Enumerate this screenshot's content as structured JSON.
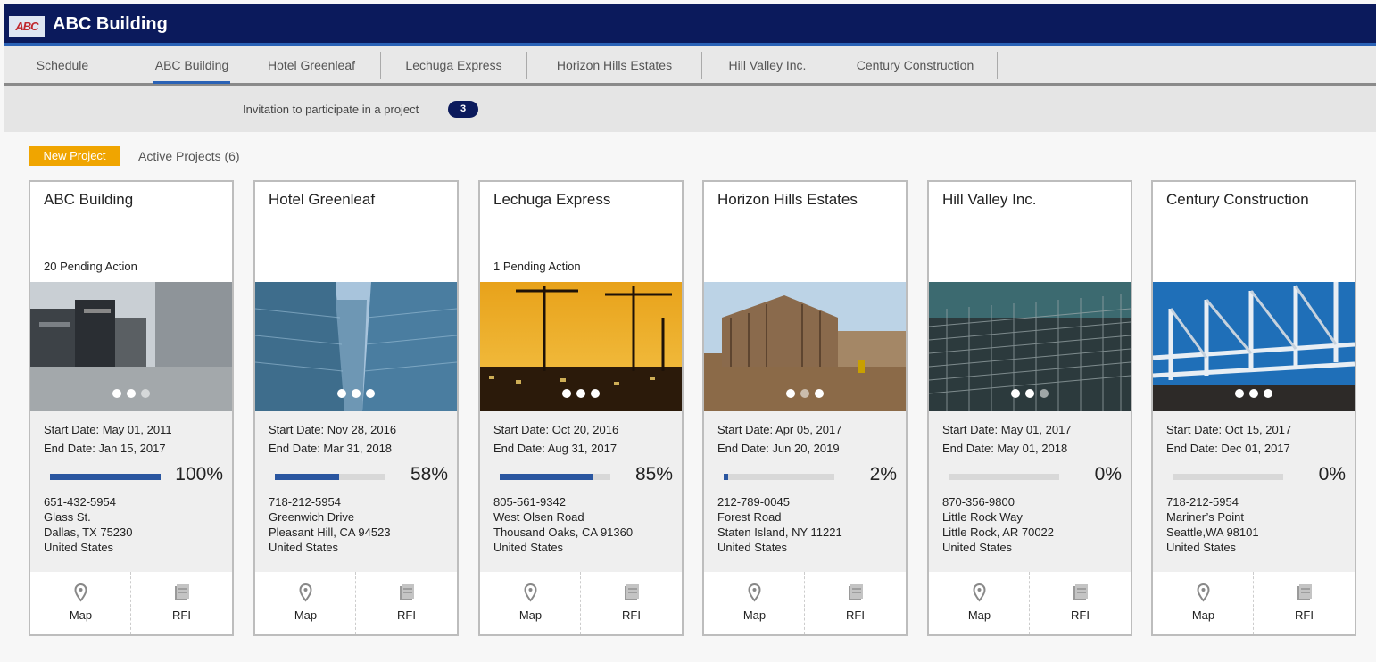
{
  "header": {
    "logo_text": "ABC",
    "title": "ABC Building"
  },
  "nav": {
    "tabs": [
      "Schedule",
      "ABC Building",
      "Hotel Greenleaf",
      "Lechuga Express",
      "Horizon Hills Estates",
      "Hill Valley Inc.",
      "Century Construction"
    ],
    "active": "ABC Building"
  },
  "notice": {
    "text": "Invitation to participate in a project",
    "count": "3"
  },
  "toolbar": {
    "new_project": "New Project",
    "active_projects": "Active Projects (6)"
  },
  "accent_color": "#f0a500",
  "brand_color": "#0b1a5c",
  "projects": [
    {
      "name": "ABC Building",
      "pending": "20 Pending Action",
      "start": "Start Date: May 01, 2011",
      "end": "End Date: Jan 15, 2017",
      "progress": 100,
      "progress_label": "100%",
      "phone": "651-432-5954",
      "street": "Glass St.",
      "city": "Dallas, TX 75230",
      "country": "United States",
      "map": "Map",
      "rfi": "RFI"
    },
    {
      "name": "Hotel Greenleaf",
      "pending": "",
      "start": "Start Date: Nov 28, 2016",
      "end": "End Date: Mar 31, 2018",
      "progress": 58,
      "progress_label": "58%",
      "phone": "718-212-5954",
      "street": "Greenwich Drive",
      "city": "Pleasant Hill, CA 94523",
      "country": "United States",
      "map": "Map",
      "rfi": "RFI"
    },
    {
      "name": "Lechuga Express",
      "pending": "1 Pending Action",
      "start": "Start Date: Oct 20, 2016",
      "end": "End Date: Aug 31, 2017",
      "progress": 85,
      "progress_label": "85%",
      "phone": "805-561-9342",
      "street": "West Olsen Road",
      "city": "Thousand Oaks, CA 91360",
      "country": "United States",
      "map": "Map",
      "rfi": "RFI"
    },
    {
      "name": "Horizon Hills Estates",
      "pending": "",
      "start": "Start Date: Apr 05, 2017",
      "end": "End Date: Jun 20, 2019",
      "progress": 2,
      "progress_label": "2%",
      "phone": "212-789-0045",
      "street": "Forest Road",
      "city": "Staten Island, NY 11221",
      "country": "United States",
      "map": "Map",
      "rfi": "RFI"
    },
    {
      "name": "Hill Valley Inc.",
      "pending": "",
      "start": "Start Date: May 01, 2017",
      "end": "End Date: May 01, 2018",
      "progress": 0,
      "progress_label": "0%",
      "phone": "870-356-9800",
      "street": "Little Rock Way",
      "city": "Little Rock, AR 70022",
      "country": "United States",
      "map": "Map",
      "rfi": "RFI"
    },
    {
      "name": "Century Construction",
      "pending": "",
      "start": "Start Date: Oct 15, 2017",
      "end": "End Date: Dec 01, 2017",
      "progress": 0,
      "progress_label": "0%",
      "phone": "718-212-5954",
      "street": "Mariner’s Point",
      "city": "Seattle,WA 98101",
      "country": "United States",
      "map": "Map",
      "rfi": "RFI"
    }
  ]
}
